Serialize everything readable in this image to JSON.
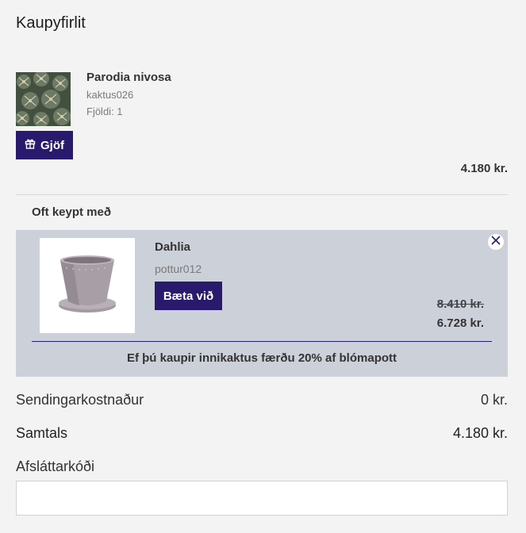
{
  "page": {
    "title": "Kaupyfirlit"
  },
  "cart_item": {
    "name": "Parodia nivosa",
    "sku": "kaktus026",
    "quantity": "Fjöldi: 1",
    "gift_label": "Gjöf",
    "price": "4.180 kr.",
    "image_icon": "cactus-photo"
  },
  "upsell": {
    "section_title": "Oft keypt með",
    "name": "Dahlia",
    "sku": "pottur012",
    "add_label": "Bæta við",
    "old_price": "8.410 kr.",
    "new_price": "6.728 kr.",
    "promo": "Ef þú kaupir innikaktus færðu 20% af blómapott",
    "image_icon": "flower-pot-photo"
  },
  "summary": {
    "shipping_label": "Sendingarkostnaður",
    "shipping_value": "0 kr.",
    "total_label": "Samtals",
    "total_value": "4.180 kr.",
    "discount_label": "Afsláttarkóði",
    "discount_value": ""
  },
  "colors": {
    "accent": "#2a1a6e",
    "upsell_bg": "#ccd0d8",
    "page_bg": "#f3f3f3"
  }
}
